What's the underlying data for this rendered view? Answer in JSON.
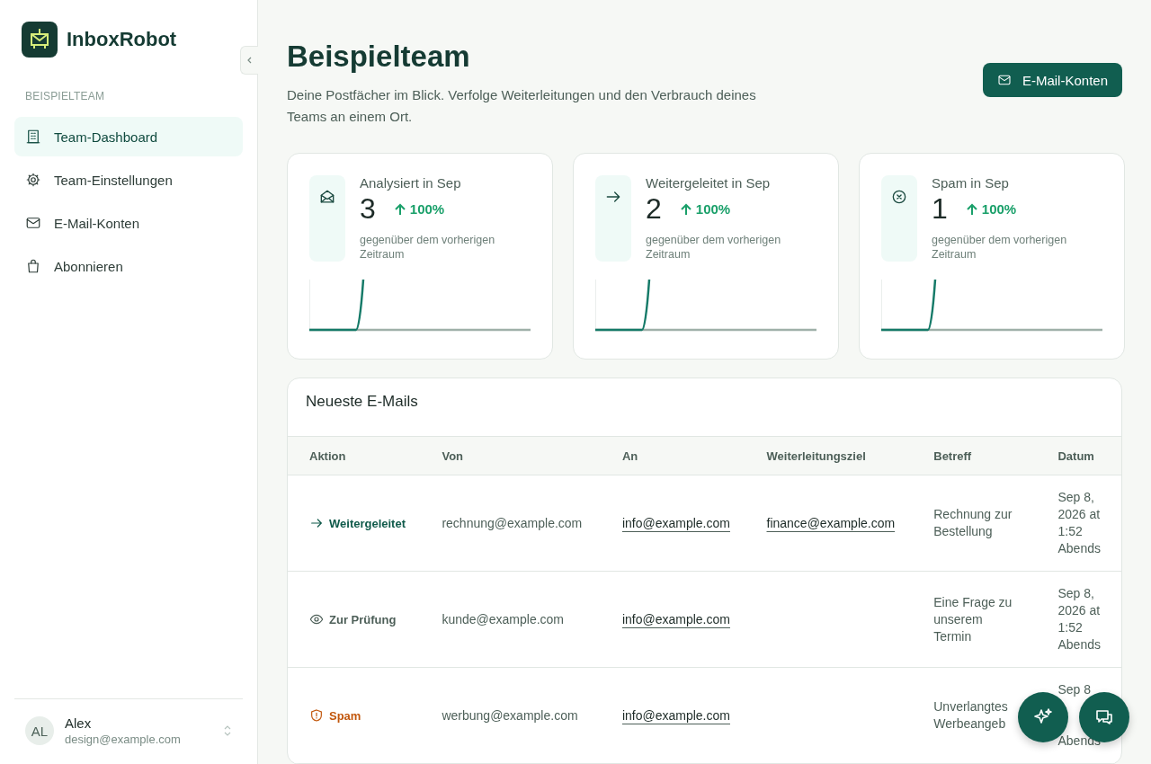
{
  "brand": {
    "name": "InboxRobot"
  },
  "sidebar": {
    "section": "BEISPIELTEAM",
    "items": [
      {
        "label": "Team-Dashboard",
        "selected": true
      },
      {
        "label": "Team-Einstellungen",
        "selected": false
      },
      {
        "label": "E-Mail-Konten",
        "selected": false
      },
      {
        "label": "Abonnieren",
        "selected": false
      }
    ],
    "user": {
      "initials": "AL",
      "name": "Alex",
      "email": "design@example.com"
    }
  },
  "header": {
    "title": "Beispielteam",
    "subtitle": "Deine Postfächer im Blick. Verfolge Weiterleitungen und den Verbrauch deines Teams an einem Ort.",
    "button": "E-Mail-Konten"
  },
  "stats": [
    {
      "label": "Analysiert in Sep",
      "value": "3",
      "change": "100%",
      "note": "gegenüber dem vorherigen Zeitraum"
    },
    {
      "label": "Weitergeleitet in Sep",
      "value": "2",
      "change": "100%",
      "note": "gegenüber dem vorherigen Zeitraum"
    },
    {
      "label": "Spam in Sep",
      "value": "1",
      "change": "100%",
      "note": "gegenüber dem vorherigen Zeitraum"
    }
  ],
  "emails": {
    "title": "Neueste E-Mails",
    "columns": [
      "Aktion",
      "Von",
      "An",
      "Weiterleitungsziel",
      "Betreff",
      "Datum"
    ],
    "rows": [
      {
        "action": {
          "kind": "forwarded",
          "label": "Weitergeleitet"
        },
        "from": "rechnung@example.com",
        "to": "info@example.com",
        "target": "finance@example.com",
        "subject": "Rechnung zur Bestellung",
        "date": [
          "Sep 8,",
          "2026 at",
          "1:52",
          "Abends"
        ]
      },
      {
        "action": {
          "kind": "review",
          "label": "Zur Prüfung"
        },
        "from": "kunde@example.com",
        "to": "info@example.com",
        "subject": "Eine Frage zu unserem Termin",
        "date": [
          "Sep 8,",
          "2026 at",
          "1:52",
          "Abends"
        ]
      },
      {
        "action": {
          "kind": "spam",
          "label": "Spam"
        },
        "from": "werbung@example.com",
        "to": "info@example.com",
        "subject": "Unverlangtes Werbeangeb",
        "date": [
          "Sep 8",
          "Abends"
        ]
      }
    ]
  }
}
